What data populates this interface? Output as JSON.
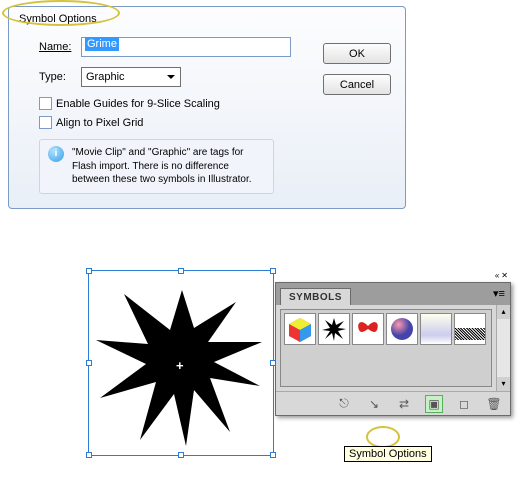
{
  "dialog": {
    "title": "Symbol Options",
    "name_label": "Name:",
    "name_value": "Grime",
    "type_label": "Type:",
    "type_value": "Graphic",
    "ok_label": "OK",
    "cancel_label": "Cancel",
    "chk_9slice": "Enable Guides for 9-Slice Scaling",
    "chk_pixelgrid": "Align to Pixel Grid",
    "info_text": "\"Movie Clip\" and \"Graphic\" are tags for Flash import. There is no difference between these two symbols in Illustrator."
  },
  "panel": {
    "tab": "SYMBOLS",
    "swatches": [
      "cube",
      "splat",
      "bow",
      "sphere",
      "gradient",
      "static"
    ],
    "footer_icons": [
      "break-link",
      "place-instance",
      "edit-symbol",
      "symbol-options",
      "new-symbol",
      "delete-symbol"
    ]
  },
  "tooltip": "Symbol Options"
}
